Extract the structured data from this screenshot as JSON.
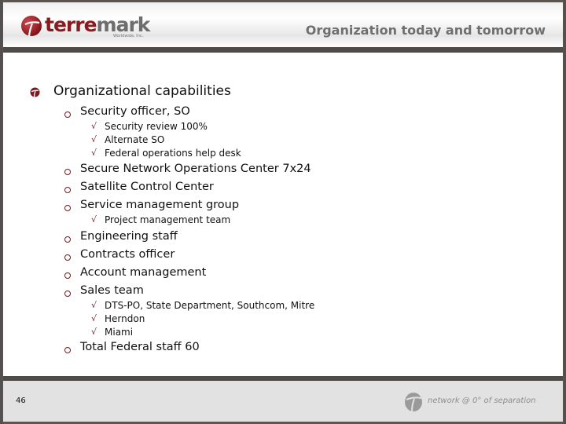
{
  "header": {
    "logo": {
      "word_part1": "terre",
      "word_part2": "mark",
      "subtitle": "Worldwide, Inc."
    },
    "title": "Organization today and tomorrow"
  },
  "content": {
    "heading": "Organizational capabilities",
    "items": [
      {
        "label": "Security officer, SO",
        "sub": [
          "Security review 100%",
          "Alternate SO",
          "Federal operations help desk"
        ]
      },
      {
        "label": "Secure Network Operations Center 7x24",
        "sub": []
      },
      {
        "label": "Satellite Control Center",
        "sub": []
      },
      {
        "label": "Service management group",
        "sub": [
          "Project management team"
        ]
      },
      {
        "label": "Engineering staff",
        "sub": []
      },
      {
        "label": "Contracts officer",
        "sub": []
      },
      {
        "label": "Account management",
        "sub": []
      },
      {
        "label": "Sales team",
        "sub": [
          "DTS-PO, State Department, Southcom, Mitre",
          "Herndon",
          "Miami"
        ]
      },
      {
        "label": "Total Federal staff 60",
        "sub": []
      }
    ],
    "check_glyph": "√"
  },
  "footer": {
    "page_number": "46",
    "tagline": "network @ 0° of separation"
  },
  "colors": {
    "brand_red": "#8b1a1f",
    "brand_gray": "#6d6d6d",
    "frame": "#4f4b48",
    "footer_bg": "#e2e2e2"
  }
}
